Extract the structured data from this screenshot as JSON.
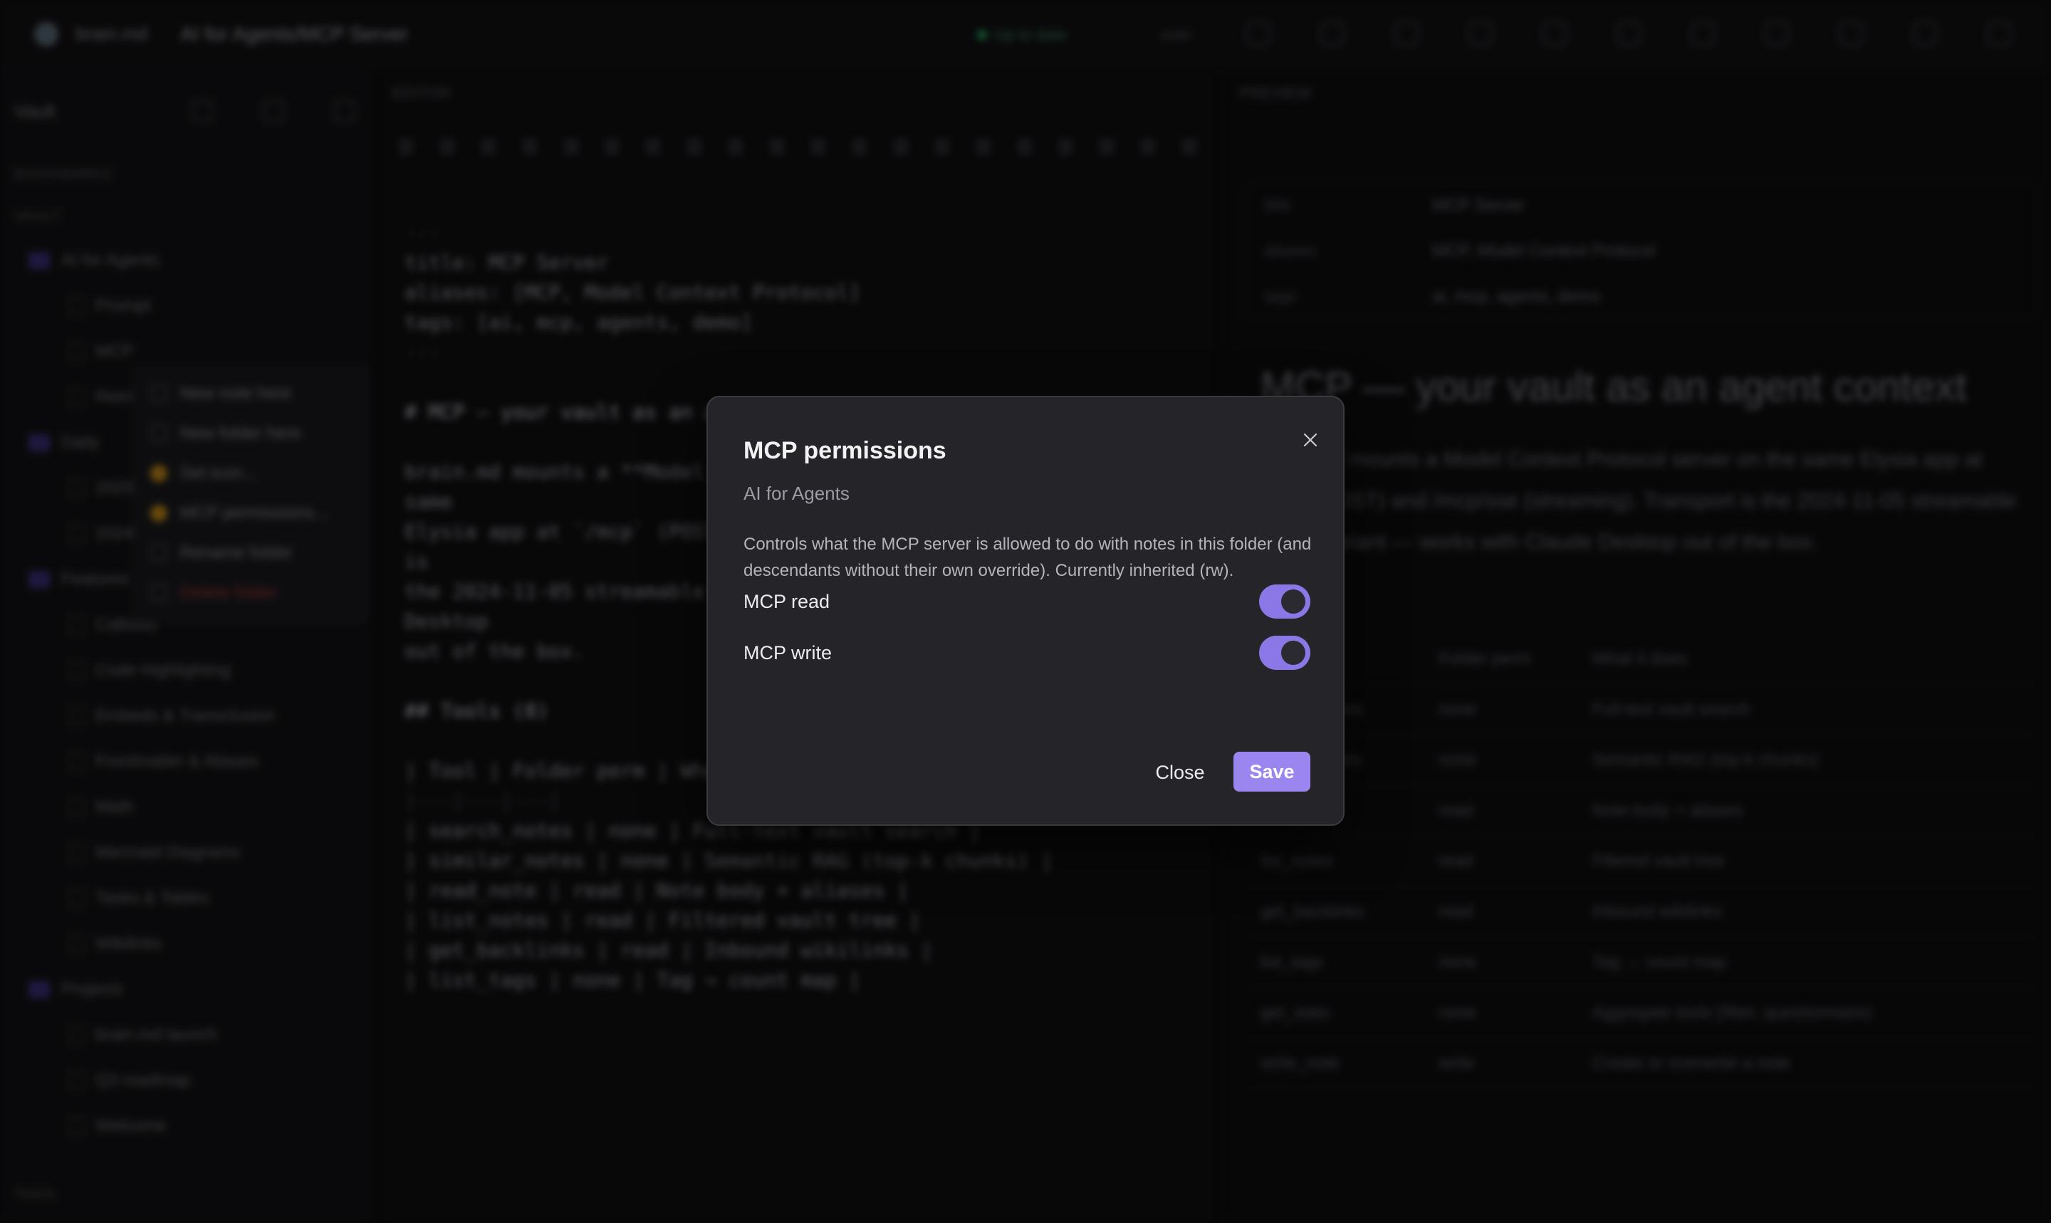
{
  "app": {
    "name": "brain.md",
    "path": "AI for Agents/MCP Server",
    "status": "Up to date",
    "user": "user"
  },
  "sidebar": {
    "title": "Vault",
    "section_bookmarks": "BOOKMARKS",
    "section_vault": "VAULT",
    "items": [
      "AI for Agents",
      "Prompt",
      "MCP",
      "Retrieval",
      "Daily",
      "2025",
      "2024",
      "Features",
      "Callouts",
      "Code Highlighting",
      "Embeds & Transclusion",
      "Frontmatter & Aliases",
      "Math",
      "Mermaid Diagrams",
      "Tasks & Tables",
      "Wikilinks",
      "Projects",
      "brain.md launch",
      "Q3 roadmap",
      "Welcome"
    ],
    "context_menu": [
      "New note here",
      "New folder here",
      "Set icon...",
      "MCP permissions...",
      "Rename folder",
      "Delete folder"
    ],
    "footer": "TAGS"
  },
  "editor": {
    "label": "EDITOR",
    "lines": [
      "---",
      "title: MCP Server",
      "aliases: [MCP, Model Context Protocol]",
      "tags: [ai, mcp, agents, demo]",
      "---",
      "",
      "# MCP — your vault as an agent context",
      "",
      "brain.md mounts a **Model Context Protocol** server on the",
      "same",
      "Elysia app at `/mcp` (POST) and `/mcp/sse` (streaming). Transport is",
      "the 2024-11-05 streamable HTTP variant — works with Claude",
      "Desktop",
      "out of the box.",
      "",
      "## Tools (8)",
      "",
      "| Tool | Folder perm | What it does |",
      "|---|---|---|",
      "| search_notes | none | Full-text vault search |",
      "| similar_notes | none | Semantic RAG (top-k chunks) |",
      "| read_note | read | Note body + aliases |",
      "| list_notes | read | Filtered vault tree |",
      "| get_backlinks | read | Inbound wikilinks |",
      "| list_tags | none | Tag → count map |"
    ]
  },
  "preview": {
    "label": "PREVIEW",
    "frontmatter": [
      {
        "k": "title",
        "v": "MCP Server"
      },
      {
        "k": "aliases",
        "v": "MCP, Model Context Protocol"
      },
      {
        "k": "tags",
        "v": "ai, mcp, agents, demo"
      }
    ],
    "title": "MCP — your vault as an agent context",
    "text": "brain.md mounts a Model Context Protocol server on the same Elysia app at /mcp (POST) and /mcp/sse (streaming). Transport is the 2024-11-05 streamable HTTP variant — works with Claude Desktop out of the box.",
    "section": "Tools (8)",
    "table_head": [
      "Tool",
      "Folder perm",
      "What it does"
    ],
    "table_rows": [
      [
        "search_notes",
        "none",
        "Full-text vault search"
      ],
      [
        "similar_notes",
        "none",
        "Semantic RAG (top-k chunks)"
      ],
      [
        "read_note",
        "read",
        "Note body + aliases"
      ],
      [
        "list_notes",
        "read",
        "Filtered vault tree"
      ],
      [
        "get_backlinks",
        "read",
        "Inbound wikilinks"
      ],
      [
        "list_tags",
        "none",
        "Tag → count map"
      ],
      [
        "get_stats",
        "none",
        "Aggregate tools (filter, questionnaire)"
      ],
      [
        "write_note",
        "write",
        "Create or overwrite a note"
      ]
    ]
  },
  "modal": {
    "title": "MCP permissions",
    "subtitle": "AI for Agents",
    "description": "Controls what the MCP server is allowed to do with notes in this folder (and descendants without their own override). Currently inherited (rw).",
    "read_label": "MCP read",
    "read_on": true,
    "write_label": "MCP write",
    "write_on": true,
    "close_label": "Close",
    "save_label": "Save",
    "accent": "#9b86f0"
  }
}
